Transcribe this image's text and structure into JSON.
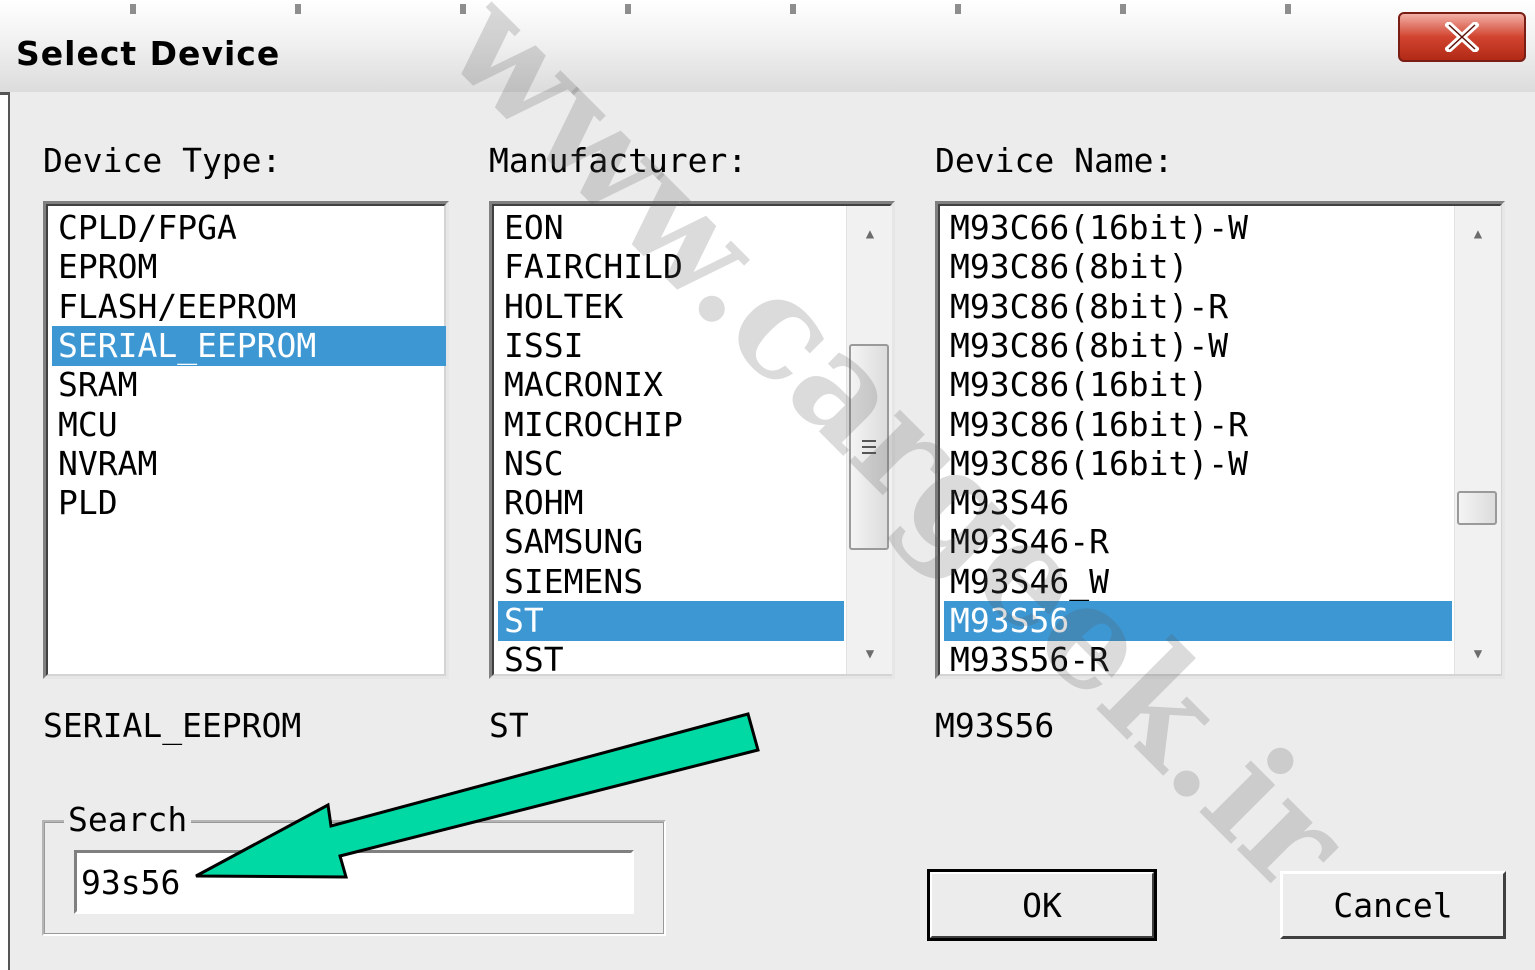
{
  "window": {
    "title": "Select Device",
    "close_glyph": "X"
  },
  "device_type": {
    "label": "Device Type:",
    "items": [
      "CPLD/FPGA",
      "EPROM",
      "FLASH/EEPROM",
      "SERIAL_EEPROM",
      "SRAM",
      "MCU",
      "NVRAM",
      "PLD"
    ],
    "selected": "SERIAL_EEPROM"
  },
  "manufacturer": {
    "label": "Manufacturer:",
    "items": [
      "EON",
      "FAIRCHILD",
      "HOLTEK",
      "ISSI",
      "MACRONIX",
      "MICROCHIP",
      "NSC",
      "ROHM",
      "SAMSUNG",
      "SIEMENS",
      "ST",
      "SST"
    ],
    "selected": "ST"
  },
  "device_name": {
    "label": "Device Name:",
    "items": [
      "M93C66(16bit)-W",
      "M93C86(8bit)",
      "M93C86(8bit)-R",
      "M93C86(8bit)-W",
      "M93C86(16bit)",
      "M93C86(16bit)-R",
      "M93C86(16bit)-W",
      "M93S46",
      "M93S46-R",
      "M93S46_W",
      "M93S56",
      "M93S56-R"
    ],
    "selected": "M93S56"
  },
  "selection_summary": {
    "device_type": "SERIAL_EEPROM",
    "manufacturer": "ST",
    "device_name": "M93S56"
  },
  "search": {
    "label": "Search",
    "value": "93s56"
  },
  "buttons": {
    "ok": "OK",
    "cancel": "Cancel"
  },
  "watermark": {
    "text": "www.cargeek.ir"
  },
  "icons": {
    "close": "close-icon",
    "scroll_up": "scroll-up-icon",
    "scroll_down": "scroll-down-icon",
    "grip": "grip-icon"
  },
  "colors": {
    "selection": "#3d97d3",
    "annotation_arrow": "#00d9a3",
    "close_button": "#c8412d"
  }
}
